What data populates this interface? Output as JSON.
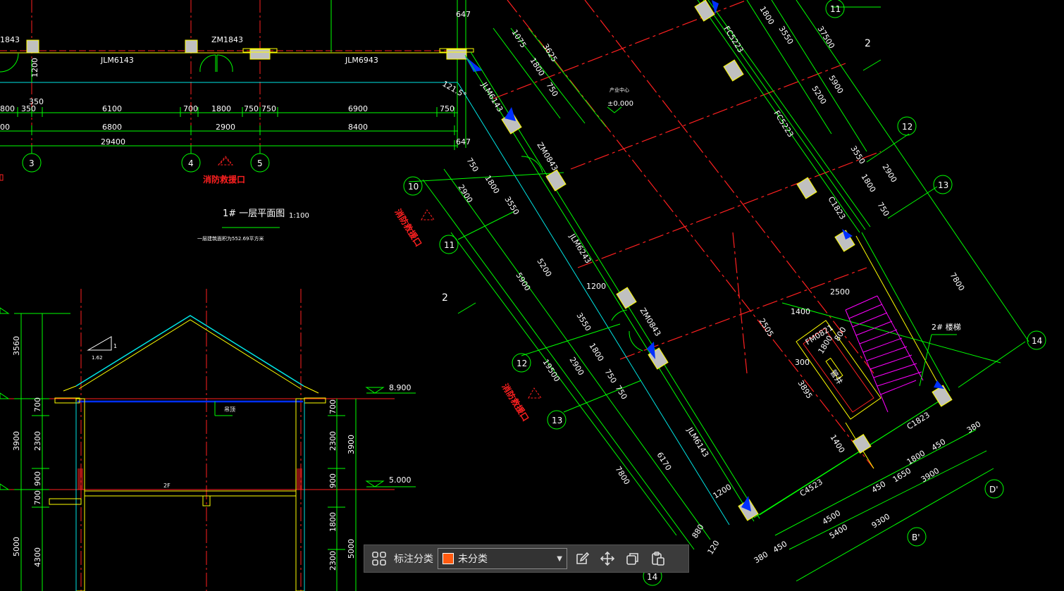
{
  "plan": {
    "title": "1# 一层平面图",
    "scale": "1:100",
    "area_note": "一层建筑面积为552.69平方米",
    "fire_entrance": "消防救援口",
    "elev_origin": "±0.000",
    "elev_note": "产业中心",
    "dims_row1": [
      "800",
      "350",
      "6100",
      "700",
      "1800",
      "750",
      "750",
      "6900",
      "750"
    ],
    "dims_row2": [
      "00",
      "6800",
      "2900",
      "8400"
    ],
    "dim_total": "29400",
    "dim_647a": "647",
    "dim_647b": "647",
    "dim_350": "350",
    "dim_1200": "1200",
    "axes": [
      "3",
      "4",
      "5"
    ],
    "doors": [
      "ZM1843",
      "JLM6143",
      "JLM6943",
      "1843"
    ]
  },
  "rotated": {
    "axes_left": [
      "10",
      "11",
      "12",
      "13"
    ],
    "axes_right": [
      "11",
      "12",
      "13",
      "14"
    ],
    "axes_bottom": [
      "B'",
      "D'",
      "14"
    ],
    "dims_left": [
      "750",
      "1800",
      "3550",
      "2900",
      "5900",
      "5200",
      "19500",
      "3550",
      "1800",
      "750",
      "750",
      "2900",
      "7800",
      "6170"
    ],
    "dims_right": [
      "1800",
      "3550",
      "37500",
      "5900",
      "5200",
      "3550",
      "1800",
      "2900",
      "750",
      "7800"
    ],
    "dims_top": [
      "1075",
      "3625",
      "1800",
      "750"
    ],
    "dims_bottom": [
      "4500",
      "5400",
      "9300",
      "450",
      "1650",
      "3900",
      "450",
      "1800",
      "380",
      "450",
      "380",
      "120",
      "880",
      "1200"
    ],
    "room_dims": [
      "2500",
      "1400",
      "2505",
      "800",
      "1800",
      "300",
      "3895",
      "1400",
      "1200"
    ],
    "tags": [
      "JLM6143",
      "ZM0843",
      "JLM6243",
      "ZM0843",
      "JLM6143",
      "FC5223",
      "FC5223",
      "C1823",
      "C1823",
      "C4523",
      "FM0821"
    ],
    "stair_label": "2# 楼梯",
    "room_label": "管井",
    "angle": "121.5°",
    "section_mark": "2",
    "section_mark2": "2"
  },
  "section": {
    "elevations": [
      "8.900",
      "5.000"
    ],
    "dims_left": [
      "3560",
      "700",
      "3900",
      "2300",
      "900",
      "700",
      "5000",
      "4300"
    ],
    "dims_right": [
      "700",
      "2300",
      "3900",
      "900",
      "1800",
      "5000",
      "2300"
    ],
    "slope": "1.62",
    "slope_top": "1",
    "ceiling_label": "吊顶",
    "floor_label": "2F"
  },
  "toolbar": {
    "label": "标注分类",
    "selected": "未分类",
    "swatch_color": "#ff5a10"
  },
  "colors": {
    "background": "#000000",
    "dim_green": "#00ff00",
    "axis_red": "#ff2020",
    "wall_yellow": "#ffff00",
    "cyan": "#00e5e5",
    "magenta": "#ff00ff"
  }
}
